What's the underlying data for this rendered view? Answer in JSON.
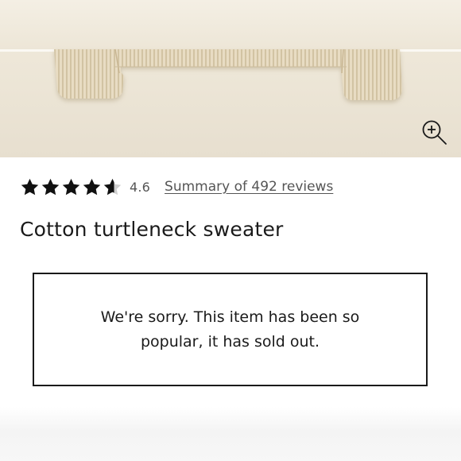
{
  "product_image": {
    "alt": "Cotton turtleneck sweater",
    "zoom_icon": "zoom-in-icon",
    "colors": {
      "knit": "#e6d9bf",
      "knit_shadow": "#c9b898",
      "background": "#ece5d6"
    }
  },
  "rating": {
    "stars_total": 5,
    "stars_value": 4.6,
    "value_label": "4.6",
    "reviews_link": "Summary of 492 reviews"
  },
  "product": {
    "title": "Cotton turtleneck sweater"
  },
  "availability": {
    "message": "We're sorry. This item has been so popular, it has sold out."
  }
}
